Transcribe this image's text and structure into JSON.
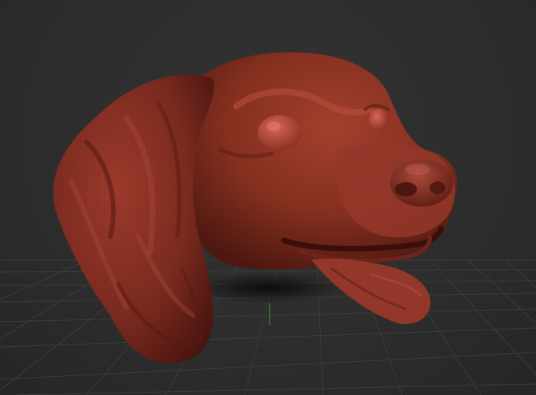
{
  "viewport": {
    "background": "#2d2d2d",
    "grid_color": "#3c3c3c",
    "axis_green": "#3f8f3f",
    "model": {
      "subject": "dog-head-sculpt",
      "material_color": "#8a2f24",
      "highlight_color": "#b24b3b",
      "shadow_color": "#4a1510"
    }
  }
}
